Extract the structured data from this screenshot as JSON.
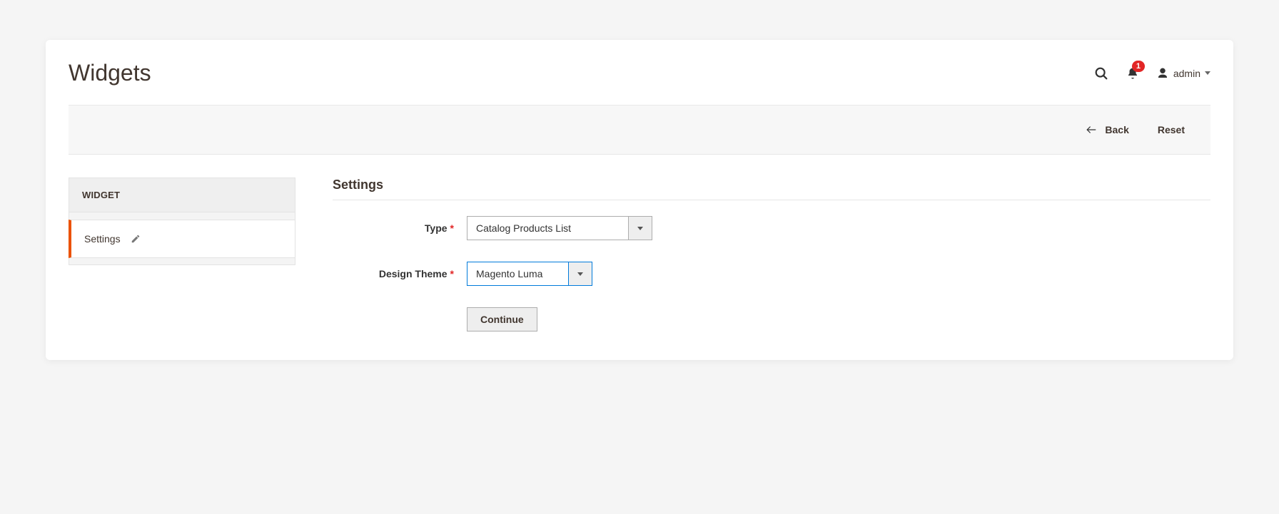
{
  "header": {
    "title": "Widgets",
    "notification_count": "1",
    "username": "admin"
  },
  "actions": {
    "back": "Back",
    "reset": "Reset"
  },
  "sidebar": {
    "heading": "WIDGET",
    "tab_label": "Settings"
  },
  "form": {
    "section_title": "Settings",
    "type_label": "Type",
    "type_value": "Catalog Products List",
    "theme_label": "Design Theme",
    "theme_value": "Magento Luma",
    "continue_label": "Continue"
  }
}
